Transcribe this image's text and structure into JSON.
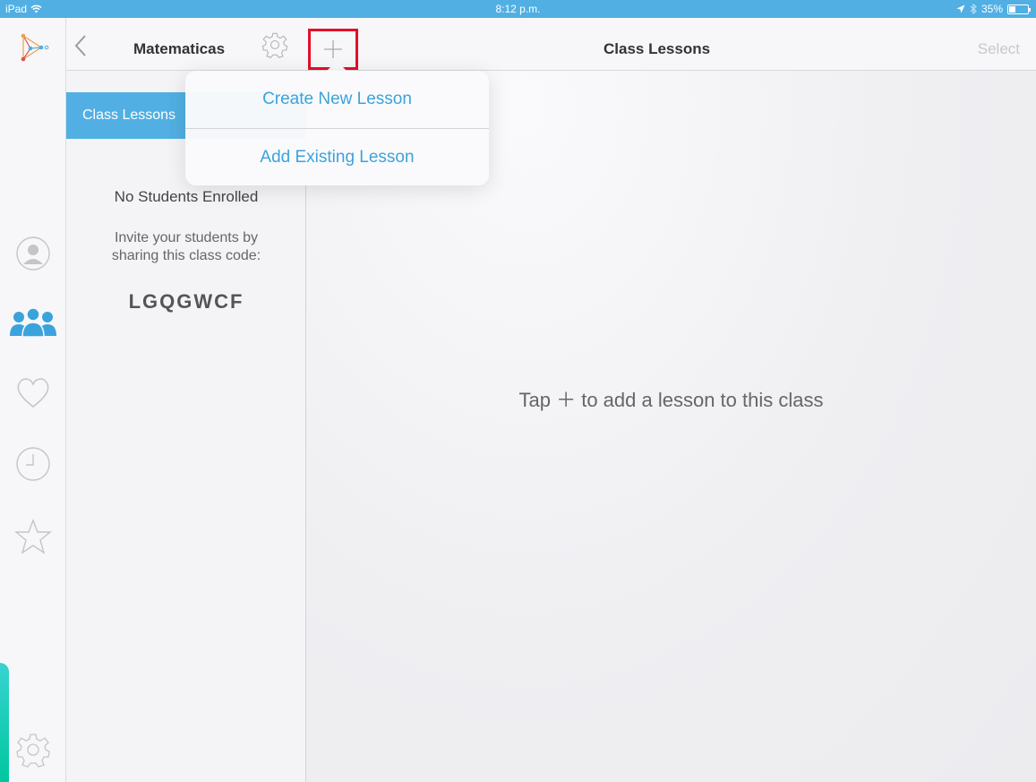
{
  "status_bar": {
    "device": "iPad",
    "time": "8:12 p.m.",
    "battery": "35%",
    "battery_level": 0.35
  },
  "navbar": {
    "class_name": "Matematicas",
    "title": "Class Lessons",
    "select_label": "Select"
  },
  "side_panel": {
    "active_tab": "Class Lessons",
    "no_students": "No Students Enrolled",
    "invite_line1": "Invite your students by",
    "invite_line2": "sharing this class code:",
    "class_code": "LGQGWCF"
  },
  "main": {
    "empty_message": "Tap ＋ to add a lesson to this class"
  },
  "popover": {
    "items": [
      {
        "label": "Create New Lesson"
      },
      {
        "label": "Add Existing Lesson"
      }
    ]
  },
  "rail": {
    "icons": [
      "app-logo-icon",
      "profile-icon",
      "classes-icon",
      "favorites-icon",
      "history-icon",
      "starred-icon",
      "settings-icon"
    ]
  },
  "colors": {
    "accent": "#51afe3",
    "link": "#3ba3dc",
    "highlight_box": "#e2102a",
    "strip": "#00c7a0"
  }
}
